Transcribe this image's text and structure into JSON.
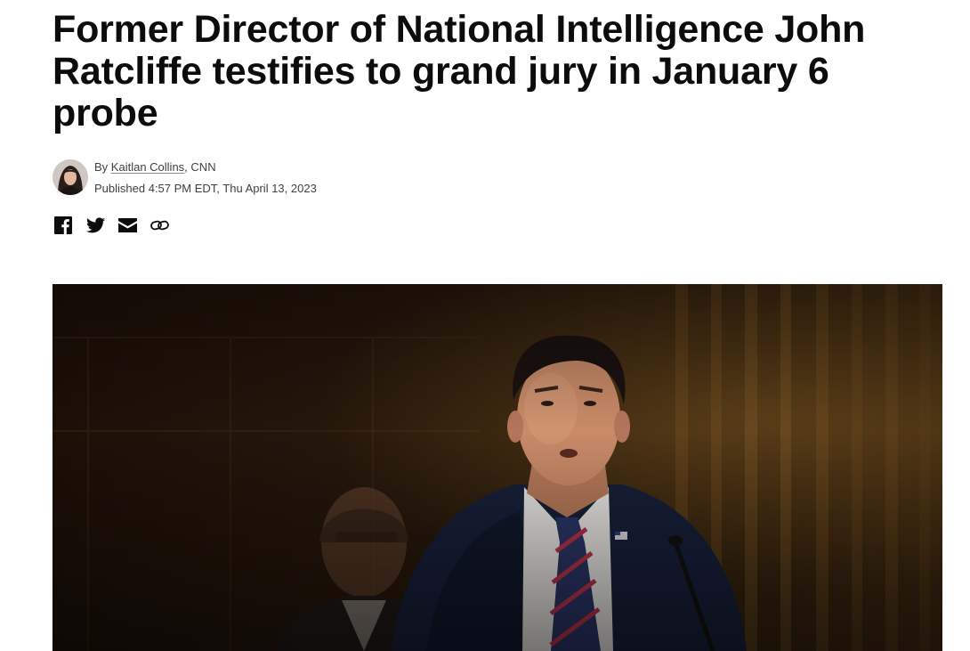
{
  "article": {
    "headline": "Former Director of National Intelligence John Ratcliffe testifies to grand jury in January 6 probe"
  },
  "byline": {
    "prefix": "By",
    "author": "Kaitlan Collins",
    "source_separator": ",",
    "source": "CNN",
    "published": "Published 4:57 PM EDT, Thu April 13, 2023"
  },
  "share": {
    "icons": [
      "facebook-icon",
      "twitter-icon",
      "email-icon",
      "link-icon"
    ]
  },
  "colors": {
    "text": "#0c0c0c",
    "meta_text": "#404040",
    "hero_background": "#1b1006"
  }
}
